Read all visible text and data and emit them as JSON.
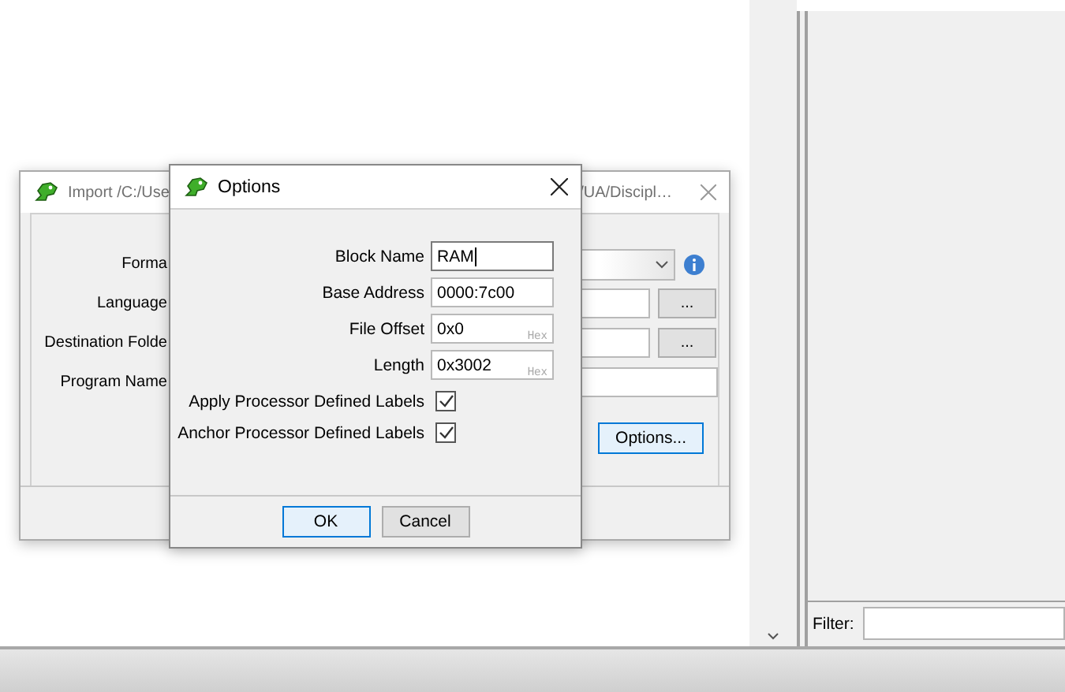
{
  "import_dialog": {
    "title_parts": [
      "Import /C:/Use",
      "/UA/Discipl…"
    ],
    "rows": [
      {
        "label": "Forma",
        "kind": "dropdown"
      },
      {
        "label": "Language",
        "kind": "browse",
        "button": "..."
      },
      {
        "label": "Destination Folde",
        "kind": "browse",
        "button": "..."
      },
      {
        "label": "Program Name",
        "kind": "text"
      }
    ],
    "options_button": "Options..."
  },
  "options_dialog": {
    "title": "Options",
    "fields": [
      {
        "label": "Block Name",
        "value": "RAM",
        "focused": true
      },
      {
        "label": "Base Address",
        "value": "0000:7c00",
        "focused": false
      },
      {
        "label": "File Offset",
        "value": "0x0",
        "hint": "Hex",
        "focused": false
      },
      {
        "label": "Length",
        "value": "0x3002",
        "hint": "Hex",
        "focused": false
      }
    ],
    "checkboxes": [
      {
        "label": "Apply Processor Defined Labels",
        "checked": true
      },
      {
        "label": "Anchor Processor Defined Labels",
        "checked": true
      }
    ],
    "buttons": [
      {
        "label": "OK",
        "focused": true
      },
      {
        "label": "Cancel",
        "focused": false
      }
    ]
  },
  "filter": {
    "label": "Filter:"
  }
}
